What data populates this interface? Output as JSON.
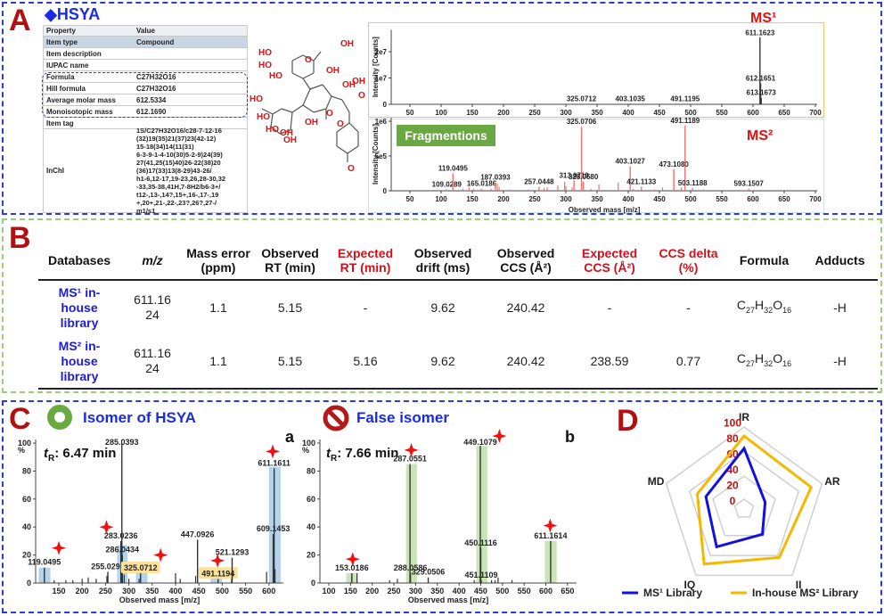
{
  "panel_a": {
    "letter": "A",
    "title": "◆HSYA",
    "table": {
      "headers": [
        "Property",
        "Value"
      ],
      "rows": [
        {
          "property": "Item type",
          "value": "Compound"
        },
        {
          "property": "Item description",
          "value": ""
        },
        {
          "property": "IUPAC name",
          "value": ""
        },
        {
          "property": "Formula",
          "value": "C27H32O16"
        },
        {
          "property": "Hill formula",
          "value": "C27H32O16"
        },
        {
          "property": "Average molar mass",
          "value": "612.5334"
        },
        {
          "property": "Monoisotopic mass",
          "value": "612.1690"
        },
        {
          "property": "Item tag",
          "value": ""
        },
        {
          "property": "InChI",
          "value": "1S/C27H32O16/c28-7-12-16\n(32)19(35)21(37)23(42-12)\n15-18(34)14(11(31)\n6-3-9-1-4-10(30)5-2-9)24(39)\n27(41,25(15)40)26-22(38)20\n(36)17(33)13(8-29)43-26/\nh1-6,12-17,19-23,26,28-30,32\n-33,35-38,41H,7-8H2/b6-3+/\nt12-,13-,14?,15+,16-,17-,19\n+,20+,21-,22-,23?,26?,27-/\nm1/s1"
        }
      ]
    },
    "structure_labels": [
      "HO",
      "OH",
      "HO",
      "OH",
      "HO",
      "OH",
      "OH",
      "HO",
      "O",
      "O",
      "O",
      "O",
      "HO",
      "HO",
      "OH",
      "OH",
      "OH",
      "O"
    ],
    "ms1_label": "MS¹",
    "ms2_label": "MS²",
    "fragments_label": "Fragmentions"
  },
  "panel_b": {
    "letter": "B",
    "headers": [
      {
        "text": "Databases",
        "highlight": false
      },
      {
        "text": "m/z",
        "highlight": false
      },
      {
        "text": "Mass error (ppm)",
        "highlight": false
      },
      {
        "text": "Observed RT (min)",
        "highlight": false
      },
      {
        "text": "Expected RT (min)",
        "highlight": true
      },
      {
        "text": "Observed drift (ms)",
        "highlight": false
      },
      {
        "text": "Observed CCS (Å²)",
        "highlight": false
      },
      {
        "text": "Expected CCS (Å²)",
        "highlight": true
      },
      {
        "text": "CCS delta (%)",
        "highlight": true
      },
      {
        "text": "Formula",
        "highlight": false
      },
      {
        "text": "Adducts",
        "highlight": false
      }
    ],
    "rows": [
      [
        "MS¹ in-house library",
        "611.1624",
        "1.1",
        "5.15",
        "-",
        "9.62",
        "240.42",
        "-",
        "-",
        "C27H32O16",
        "-H"
      ],
      [
        "MS² in-house library",
        "611.1624",
        "1.1",
        "5.15",
        "5.16",
        "9.62",
        "240.42",
        "238.59",
        "0.77",
        "C27H32O16",
        "-H"
      ]
    ]
  },
  "panel_c": {
    "letter": "C",
    "a": {
      "title": "Isomer of HSYA",
      "tag": "a",
      "tr_label": "t",
      "tr_sub": "R",
      "tr_value": ": 6.47 min",
      "icon": "green-ring-icon"
    },
    "b": {
      "title": "False isomer",
      "tag": "b",
      "tr_label": "t",
      "tr_sub": "R",
      "tr_value": ": 7.66 min",
      "icon": "prohibited-icon"
    }
  },
  "panel_d": {
    "letter": "D"
  },
  "colors": {
    "accent_blue": "#1a2ae6",
    "panel_letter": "#b01010",
    "ms_red": "#e01010",
    "highlight_blue": "#a9cbe9",
    "highlight_green": "#bfe0a8",
    "ms1_line": "#1010e0",
    "ms2_line": "#f5b800"
  },
  "chart_data": [
    {
      "id": "ms1",
      "type": "bar",
      "xlabel": "",
      "ylabel": "Intensity [Counts]",
      "xlim": [
        20,
        700
      ],
      "ylim": [
        0,
        27000000
      ],
      "xticks": [
        "50",
        "100",
        "150",
        "200",
        "250",
        "300",
        "350",
        "400",
        "450",
        "500",
        "550",
        "600",
        "650",
        "700"
      ],
      "yticks": [
        {
          "value": 0,
          "label": "0"
        },
        {
          "value": 10000000,
          "label": "1e7"
        },
        {
          "value": 20000000,
          "label": "2e7"
        }
      ],
      "labeled_peaks": [
        {
          "mz": "611.1623",
          "y": 25500000
        },
        {
          "mz": "612.1651",
          "y": 8000000
        },
        {
          "mz": "613.1673",
          "y": 2500000
        },
        {
          "mz": "325.0712",
          "y": 100000
        },
        {
          "mz": "403.1035",
          "y": 200000
        },
        {
          "mz": "491.1195",
          "y": 100000
        }
      ],
      "other_peaks": []
    },
    {
      "id": "ms2",
      "type": "bar",
      "xlabel": "Observed mass [m/z]",
      "ylabel": "Intensity [Counts]",
      "xlim": [
        20,
        700
      ],
      "ylim": [
        0,
        1000000
      ],
      "xticks": [
        "50",
        "100",
        "150",
        "200",
        "250",
        "300",
        "350",
        "400",
        "450",
        "500",
        "550",
        "600",
        "650",
        "700"
      ],
      "yticks": [
        {
          "value": 0,
          "label": "0"
        },
        {
          "value": 500000,
          "label": "5e5"
        },
        {
          "value": 1000000,
          "label": "1e6"
        }
      ],
      "labeled_peaks": [
        {
          "mz": "109.0289",
          "y": 20000
        },
        {
          "mz": "119.0495",
          "y": 250000
        },
        {
          "mz": "165.0186",
          "y": 30000
        },
        {
          "mz": "187.0393",
          "y": 120000
        },
        {
          "mz": "257.0448",
          "y": 60000
        },
        {
          "mz": "313.0710",
          "y": 150000
        },
        {
          "mz": "325.0706",
          "y": 920000
        },
        {
          "mz": "328.0580",
          "y": 130000
        },
        {
          "mz": "403.1027",
          "y": 350000
        },
        {
          "mz": "421.1133",
          "y": 60000
        },
        {
          "mz": "473.1080",
          "y": 310000
        },
        {
          "mz": "491.1189",
          "y": 940000
        },
        {
          "mz": "503.1188",
          "y": 40000
        },
        {
          "mz": "593.1507",
          "y": 30000
        }
      ],
      "other_peaks": [
        [
          135,
          30000
        ],
        [
          145,
          50000
        ],
        [
          152,
          30000
        ],
        [
          180,
          30000
        ],
        [
          190,
          100000
        ],
        [
          193,
          50000
        ],
        [
          210,
          20000
        ],
        [
          240,
          20000
        ],
        [
          265,
          40000
        ],
        [
          270,
          50000
        ],
        [
          287,
          80000
        ],
        [
          298,
          130000
        ],
        [
          300,
          70000
        ],
        [
          310,
          50000
        ],
        [
          340,
          30000
        ],
        [
          353,
          90000
        ],
        [
          384,
          120000
        ],
        [
          408,
          30000
        ],
        [
          442,
          20000
        ],
        [
          455,
          50000
        ],
        [
          485,
          50000
        ],
        [
          521,
          20000
        ]
      ]
    },
    {
      "id": "c_a",
      "type": "bar",
      "xlabel": "Observed mass [m/z]",
      "ylabel": "%",
      "xlim": [
        100,
        630
      ],
      "ylim": [
        0,
        100
      ],
      "xticks": [
        "150",
        "200",
        "250",
        "300",
        "350",
        "400",
        "450",
        "500",
        "550",
        "600"
      ],
      "yticks": [
        {
          "value": 0,
          "label": "0"
        },
        {
          "value": 20,
          "label": "20"
        },
        {
          "value": 40,
          "label": "40"
        },
        {
          "value": 60,
          "label": "60"
        },
        {
          "value": 80,
          "label": "80"
        },
        {
          "value": 100,
          "label": "100"
        }
      ],
      "labeled_peaks": [
        {
          "mz": "119.0495",
          "y": 11
        },
        {
          "mz": "255.0291",
          "y": 8
        },
        {
          "mz": "283.0236",
          "y": 30
        },
        {
          "mz": "285.0393",
          "y": 100
        },
        {
          "mz": "286.0434",
          "y": 20
        },
        {
          "mz": "325.0712",
          "y": 7,
          "boxed": true
        },
        {
          "mz": "447.0926",
          "y": 31
        },
        {
          "mz": "491.1194",
          "y": 3,
          "boxed": true
        },
        {
          "mz": "521.1293",
          "y": 18
        },
        {
          "mz": "609.1453",
          "y": 35
        },
        {
          "mz": "611.1611",
          "y": 82
        }
      ],
      "other_peaks": [
        [
          140,
          2
        ],
        [
          165,
          2
        ],
        [
          180,
          2
        ],
        [
          200,
          3
        ],
        [
          213,
          4
        ],
        [
          230,
          3
        ],
        [
          253,
          5
        ],
        [
          290,
          6
        ],
        [
          300,
          3
        ],
        [
          322,
          3
        ],
        [
          400,
          7
        ],
        [
          410,
          3
        ],
        [
          443,
          5
        ],
        [
          520,
          3
        ],
        [
          595,
          8
        ],
        [
          613,
          10
        ]
      ],
      "highlights": [
        [
          107,
          132,
          11
        ],
        [
          275,
          297,
          27
        ],
        [
          315,
          340,
          10
        ],
        [
          475,
          500,
          5
        ],
        [
          600,
          625,
          83
        ]
      ],
      "markers": [
        [
          150,
          25
        ],
        [
          252,
          40
        ],
        [
          368,
          20
        ],
        [
          490,
          16
        ],
        [
          608,
          94
        ]
      ]
    },
    {
      "id": "c_b",
      "type": "bar",
      "xlabel": "Observed mass [m/z]",
      "ylabel": "%",
      "xlim": [
        80,
        665
      ],
      "ylim": [
        0,
        100
      ],
      "xticks": [
        "100",
        "150",
        "200",
        "250",
        "300",
        "350",
        "400",
        "450",
        "500",
        "550",
        "600",
        "650"
      ],
      "yticks": [
        {
          "value": 0,
          "label": "0"
        },
        {
          "value": 20,
          "label": "20"
        },
        {
          "value": 40,
          "label": "40"
        },
        {
          "value": 60,
          "label": "60"
        },
        {
          "value": 80,
          "label": "80"
        },
        {
          "value": 100,
          "label": "100"
        }
      ],
      "labeled_peaks": [
        {
          "mz": "153.0186",
          "y": 7
        },
        {
          "mz": "287.0551",
          "y": 85
        },
        {
          "mz": "288.0586",
          "y": 7
        },
        {
          "mz": "329.0506",
          "y": 4
        },
        {
          "mz": "449.1079",
          "y": 98
        },
        {
          "mz": "450.1116",
          "y": 25
        },
        {
          "mz": "451.1109",
          "y": 2
        },
        {
          "mz": "611.1614",
          "y": 30
        }
      ],
      "other_peaks": [
        [
          165,
          7
        ],
        [
          240,
          2
        ],
        [
          258,
          3
        ],
        [
          435,
          2
        ],
        [
          475,
          2
        ],
        [
          483,
          2
        ],
        [
          490,
          4
        ],
        [
          522,
          2
        ]
      ],
      "highlights": [
        [
          140,
          165,
          7
        ],
        [
          278,
          303,
          85
        ],
        [
          440,
          465,
          98
        ],
        [
          598,
          625,
          30
        ]
      ],
      "markers": [
        [
          155,
          17
        ],
        [
          290,
          95
        ],
        [
          493,
          105
        ],
        [
          610,
          41
        ]
      ]
    },
    {
      "id": "radar",
      "type": "radar",
      "axes": [
        "IR",
        "AR",
        "II",
        "IQ",
        "MD"
      ],
      "rlim": [
        0,
        100
      ],
      "rticks": [
        "0",
        "20",
        "40",
        "60",
        "80",
        "100"
      ],
      "legend_position": "bottom",
      "series": [
        {
          "name": "MS¹ Library",
          "color": "#1010e0",
          "values": [
            74,
            27,
            38,
            57,
            49
          ]
        },
        {
          "name": "In-house MS² Library",
          "color": "#f5b800",
          "values": [
            89,
            86,
            73,
            83,
            60
          ]
        }
      ]
    }
  ]
}
